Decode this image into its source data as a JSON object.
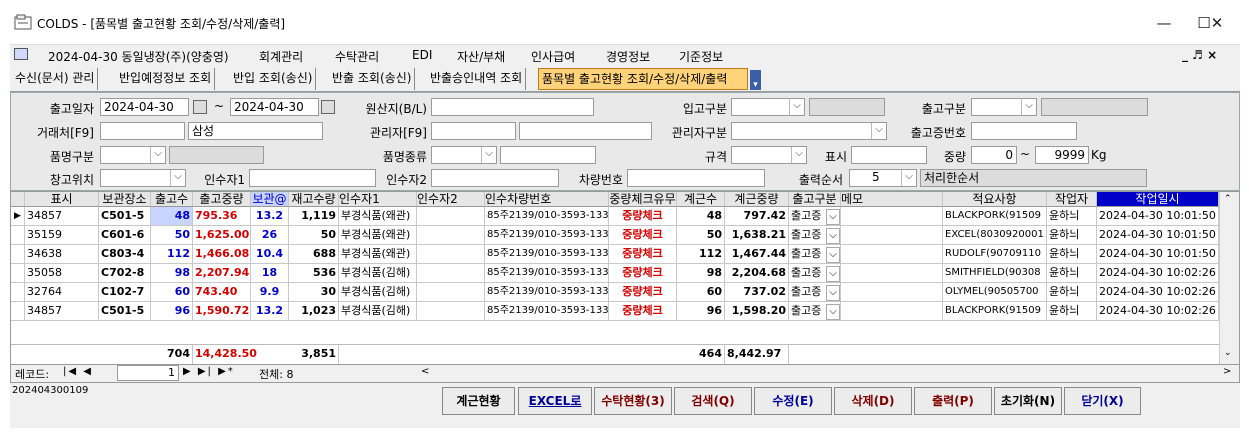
{
  "window": {
    "title": "COLDS - [품목별 출고현황 조회/수정/삭제/출력]",
    "minimize": "—",
    "maximize": "☐",
    "close": "✕"
  },
  "menubar": {
    "date_company": "2024-04-30 동일냉장(주)(양충영)",
    "items": [
      "회계관리",
      "수탁관리",
      "EDI",
      "자산/부채",
      "인사급여",
      "경영정보",
      "기준정보"
    ],
    "right_controls": "_ ♬ ×"
  },
  "tabs": [
    {
      "label": "수신(문서) 관리"
    },
    {
      "label": "반입예정정보 조회"
    },
    {
      "label": "반입 조회(송신)"
    },
    {
      "label": "반출 조회(송신)"
    },
    {
      "label": "반출승인내역 조회"
    },
    {
      "label": "품목별 출고현황 조회/수정/삭제/출력"
    }
  ],
  "form": {
    "ship_date_label": "출고일자",
    "ship_date_from": "2024-04-30",
    "ship_date_to": "2024-04-30",
    "tilde": "~",
    "bl_label": "원산지(B/L)",
    "bl_value": "",
    "in_type_label": "입고구분",
    "out_type_label": "출고구분",
    "client_label": "거래처[F9]",
    "client_code": "",
    "client_name": "삼성",
    "manager_label": "관리자[F9]",
    "manager_type_label": "관리자구분",
    "cert_no_label": "출고증번호",
    "item_type_label": "품명구분",
    "item_kind_label": "품명종류",
    "spec_label": "규격",
    "display_label": "표시",
    "weight_label": "중량",
    "weight_from": "0",
    "weight_tilde": "~",
    "weight_to": "9999",
    "weight_unit": "Kg",
    "location_label": "창고위치",
    "receiver1_label": "인수자1",
    "receiver2_label": "인수자2",
    "vehicle_label": "차량번호",
    "out_order_label": "출력순서",
    "out_order_value": "5",
    "out_order_desc": "처리한순서"
  },
  "grid": {
    "headers": [
      "표시",
      "보관장소",
      "출고수",
      "출고중량",
      "보관@",
      "재고수량",
      "인수자1",
      "인수자2",
      "인수차량번호",
      "중량체크유무",
      "계근수",
      "계근중량",
      "출고구분",
      "메모",
      "적요사항",
      "작업자",
      "작업일시"
    ],
    "rows": [
      {
        "mark": "34857",
        "loc": "C501-5",
        "qty": "48",
        "weight": "795.36",
        "fee": "13.2",
        "stock": "1,119",
        "r1": "부경식품(왜관)",
        "r2": "",
        "vehicle": "85주2139/010-3593-133",
        "check": "중량체크",
        "wcount": "48",
        "wweight": "797.42",
        "otype": "출고증",
        "memo": "",
        "desc": "BLACKPORK(91509",
        "worker": "윤하늬",
        "time": "2024-04-30 10:01:50"
      },
      {
        "mark": "35159",
        "loc": "C601-6",
        "qty": "50",
        "weight": "1,625.00",
        "fee": "26",
        "stock": "50",
        "r1": "부경식품(왜관)",
        "r2": "",
        "vehicle": "85주2139/010-3593-133",
        "check": "중량체크",
        "wcount": "50",
        "wweight": "1,638.21",
        "otype": "출고증",
        "memo": "",
        "desc": "EXCEL(8030920001",
        "worker": "윤하늬",
        "time": "2024-04-30 10:01:50"
      },
      {
        "mark": "34638",
        "loc": "C803-4",
        "qty": "112",
        "weight": "1,466.08",
        "fee": "10.4",
        "stock": "688",
        "r1": "부경식품(왜관)",
        "r2": "",
        "vehicle": "85주2139/010-3593-133",
        "check": "중량체크",
        "wcount": "112",
        "wweight": "1,467.44",
        "otype": "출고증",
        "memo": "",
        "desc": "RUDOLF(90709110",
        "worker": "윤하늬",
        "time": "2024-04-30 10:01:50"
      },
      {
        "mark": "35058",
        "loc": "C702-8",
        "qty": "98",
        "weight": "2,207.94",
        "fee": "18",
        "stock": "536",
        "r1": "부경식품(김해)",
        "r2": "",
        "vehicle": "85주2139/010-3593-133",
        "check": "중량체크",
        "wcount": "98",
        "wweight": "2,204.68",
        "otype": "출고증",
        "memo": "",
        "desc": "SMITHFIELD(90308",
        "worker": "윤하늬",
        "time": "2024-04-30 10:02:26"
      },
      {
        "mark": "32764",
        "loc": "C102-7",
        "qty": "60",
        "weight": "743.40",
        "fee": "9.9",
        "stock": "30",
        "r1": "부경식품(김해)",
        "r2": "",
        "vehicle": "85주2139/010-3593-133",
        "check": "중량체크",
        "wcount": "60",
        "wweight": "737.02",
        "otype": "출고증",
        "memo": "",
        "desc": "OLYMEL(90505700",
        "worker": "윤하늬",
        "time": "2024-04-30 10:02:26"
      },
      {
        "mark": "34857",
        "loc": "C501-5",
        "qty": "96",
        "weight": "1,590.72",
        "fee": "13.2",
        "stock": "1,023",
        "r1": "부경식품(김해)",
        "r2": "",
        "vehicle": "85주2139/010-3593-133",
        "check": "중량체크",
        "wcount": "96",
        "wweight": "1,598.20",
        "otype": "출고증",
        "memo": "",
        "desc": "BLACKPORK(91509",
        "worker": "윤하늬",
        "time": "2024-04-30 10:02:26"
      }
    ],
    "totals": {
      "qty": "704",
      "weight": "14,428.50",
      "stock": "3,851",
      "wcount": "464",
      "wweight": "8,442.97"
    }
  },
  "navbar": {
    "record_label": "레코드:",
    "current": "1",
    "total_label": "전체: 8"
  },
  "status_text": "202404300109",
  "buttons": [
    {
      "label": "계근현황",
      "color": "#000000"
    },
    {
      "label": "EXCEL로",
      "color": "#000099"
    },
    {
      "label": "수탁현황(3)",
      "color": "#800000"
    },
    {
      "label": "검색(Q)",
      "color": "#800000"
    },
    {
      "label": "수정(E)",
      "color": "#000099"
    },
    {
      "label": "삭제(D)",
      "color": "#800000"
    },
    {
      "label": "출력(P)",
      "color": "#800000"
    },
    {
      "label": "초기화(N)",
      "color": "#000000"
    },
    {
      "label": "닫기(X)",
      "color": "#000099"
    }
  ]
}
